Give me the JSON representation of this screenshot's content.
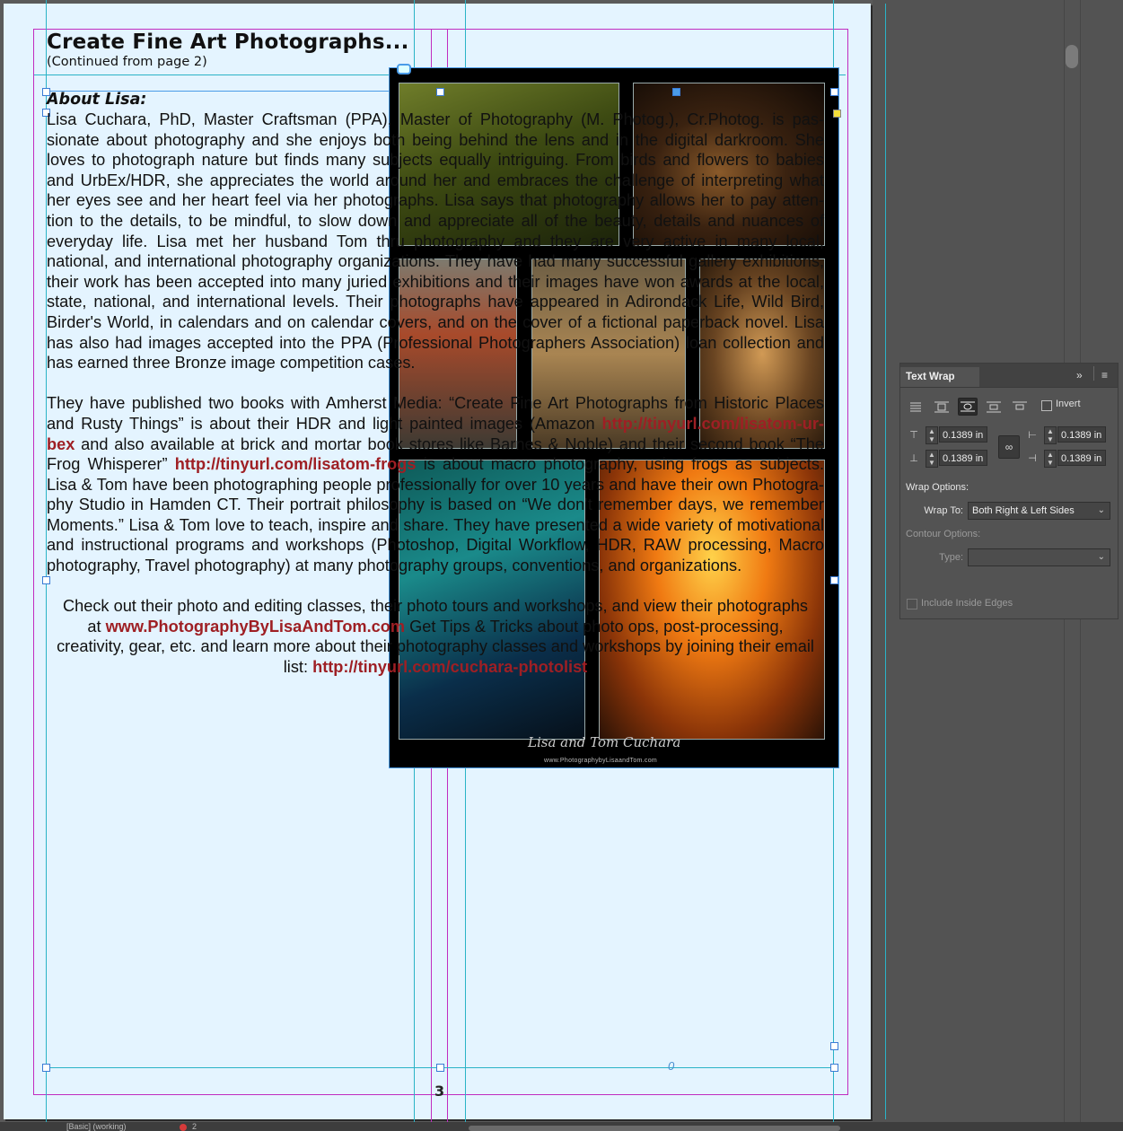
{
  "document": {
    "heading": "Create Fine Art Photographs...",
    "subheading": "(Continued from page 2)",
    "about_title": "About Lisa:",
    "paragraph1_lines": [
      "Lisa Cuchara, PhD, Master Craftsman (PPA), Master of Photography (M. Photog.), Cr.Photog. is pas-",
      "sionate about photography and she enjoys both being behind the lens and in the digital darkroom. She",
      "loves to photograph nature but finds many subjects equally intriguing. From birds and flowers to babies",
      "and UrbEx/HDR, she appreciates the world around her and embraces the challenge of interpreting what",
      "her eyes see and her heart feel via her photographs. Lisa says that photography allows her to pay atten-",
      "tion to the details, to be mindful, to slow down and appreciate all of the beauty, details and nuances of",
      "everyday life. Lisa met her husband Tom thru photography and they are very active in many local,",
      "national, and international photography organizations. They have had many successful gallery exhibitions,",
      "their work has been accepted into many juried exhibitions and their images have won awards at the local,",
      "state, national, and international levels. Their photographs have appeared in Adirondack Life, Wild Bird,",
      "Birder's World, in calendars and on calendar covers, and on the cover of a fictional paperback novel. Lisa",
      "has also had images accepted into the PPA (Professional Photographers Association) loan collection and",
      "has earned three Bronze image competition cases."
    ],
    "paragraph2_line1": "They have published two books with Amherst Media: “Create Fine Art Photographs from Historic Places",
    "paragraph2_line2_pre": "and Rusty Things” is about their HDR and light painted images (Amazon ",
    "paragraph2_link1_a": "http://tinyurl.com/lisatom-ur-",
    "paragraph2_link1_b": "bex",
    "paragraph2_line3_post": " and also available at brick and mortar book stores like Barnes & Noble) and their second book “The",
    "paragraph2_line4_pre": "Frog Whisperer” ",
    "paragraph2_link2": "http://tinyurl.com/lisatom-frogs",
    "paragraph2_line4_post": " is about macro photography, using frogs as subjects.",
    "paragraph2_rest": [
      "Lisa & Tom have been photographing people professionally for over 10 years and have their own Photogra-",
      "phy Studio in Hamden CT. Their portrait philosophy is based on “We don't remember days, we remember",
      "Moments.”  Lisa & Tom love to teach, inspire and share. They have presented a wide variety of motivational",
      "and instructional programs and workshops (Photoshop, Digital Workflow, HDR, RAW processing, Macro",
      "photography, Travel photography) at many photography groups, conventions, and organizations."
    ],
    "paragraph3_line1": "Check out their photo and editing classes, their photo tours and workshops, and view their photographs",
    "paragraph3_line2_pre": "at ",
    "paragraph3_link1": "www.PhotographyByLisaAndTom.com",
    "paragraph3_line2_post": " Get Tips & Tricks about photo ops, post-processing,",
    "paragraph3_line3": "creativity, gear, etc. and learn more about their photography classes and workshops by joining their email",
    "paragraph3_line4_pre": "list:  ",
    "paragraph3_link2": "http://tinyurl.com/cuchara-photolist",
    "image_signature": "Lisa and Tom Cuchara",
    "image_signature_url": "www.PhotographybyLisaandTom.com",
    "page_number": "3",
    "frame_marker": "0"
  },
  "text_wrap_panel": {
    "title": "Text Wrap",
    "collapse_icon": "double-chevron-right-icon",
    "menu_icon": "hamburger-menu-icon",
    "wrap_buttons": [
      "no-wrap-icon",
      "wrap-bounding-box-icon",
      "wrap-object-shape-icon",
      "jump-object-icon",
      "jump-to-next-column-icon"
    ],
    "selected_wrap_index": 2,
    "invert_label": "Invert",
    "invert_checked": false,
    "top_offset": "0.1389 in",
    "bottom_offset": "0.1389 in",
    "left_offset": "0.1389 in",
    "right_offset": "0.1389 in",
    "wrap_options_label": "Wrap Options:",
    "wrap_to_label": "Wrap To:",
    "wrap_to_value": "Both Right & Left Sides",
    "contour_options_label": "Contour Options:",
    "type_label": "Type:",
    "type_value": "",
    "include_inside_edges_label": "Include Inside Edges",
    "include_inside_edges_checked": false
  },
  "status_bar": {
    "text": "[Basic] (working)",
    "error_count": "2"
  },
  "colors": {
    "page": "#e4f4ff",
    "link": "#9e1f24",
    "margin_guide": "#c02cc0",
    "column_guide": "#2ab3c7",
    "frame_edge": "#4a9be8"
  }
}
